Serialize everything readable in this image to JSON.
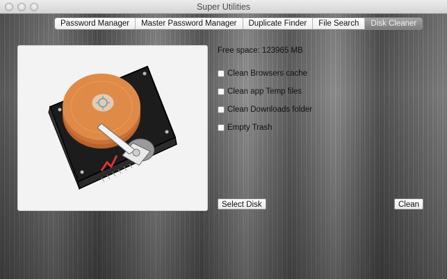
{
  "window": {
    "title": "Super Utilities"
  },
  "tabs": [
    {
      "label": "Password Manager",
      "active": false
    },
    {
      "label": "Master Password Manager",
      "active": false
    },
    {
      "label": "Duplicate Finder",
      "active": false
    },
    {
      "label": "File Search",
      "active": false
    },
    {
      "label": "Disk Cleaner",
      "active": true
    }
  ],
  "disk": {
    "free_space": "Free space: 123965 MB"
  },
  "options": [
    {
      "label": "Clean Browsers cache",
      "checked": false
    },
    {
      "label": "Clean app Temp files",
      "checked": false
    },
    {
      "label": "Clean Downloads folder",
      "checked": false
    },
    {
      "label": "Empty Trash",
      "checked": false
    }
  ],
  "buttons": {
    "select_disk": "Select Disk",
    "clean": "Clean"
  },
  "colors": {
    "platter": "#e08a48",
    "actuator_arm": "#e8e8e8",
    "active_tab": "#8f8f8f"
  }
}
